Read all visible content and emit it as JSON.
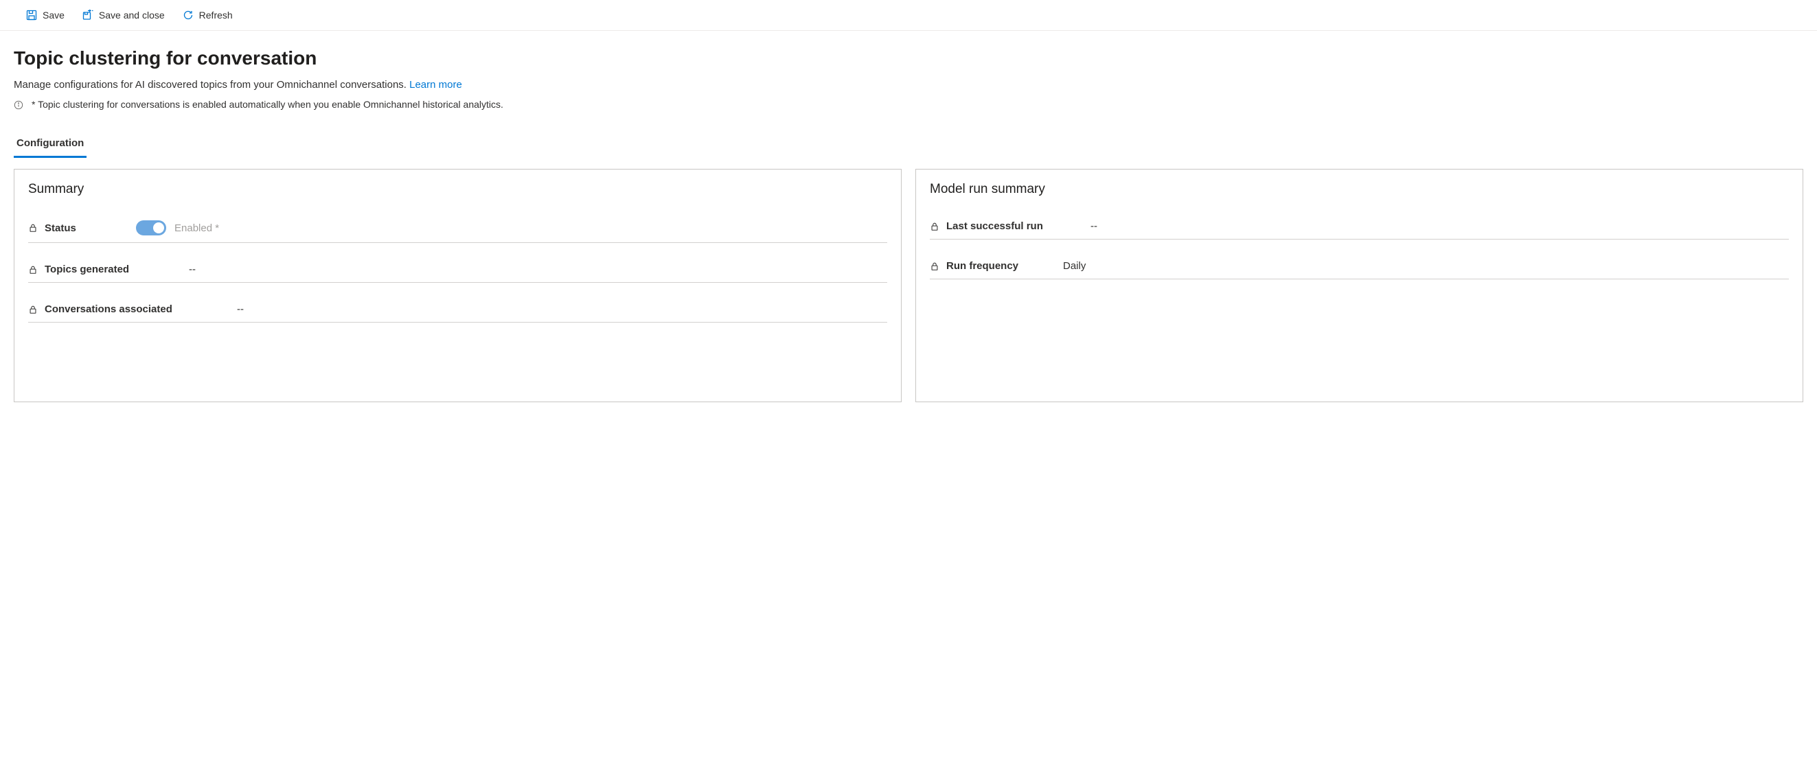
{
  "toolbar": {
    "save_label": "Save",
    "save_close_label": "Save and close",
    "refresh_label": "Refresh"
  },
  "header": {
    "title": "Topic clustering for conversation",
    "subtitle": "Manage configurations for AI discovered topics from your Omnichannel conversations. ",
    "learn_more": "Learn more",
    "info_note": "* Topic clustering for conversations is enabled automatically when you enable Omnichannel historical analytics."
  },
  "tabs": {
    "configuration": "Configuration"
  },
  "summary_panel": {
    "title": "Summary",
    "status_label": "Status",
    "status_value": "Enabled *",
    "topics_generated_label": "Topics generated",
    "topics_generated_value": "--",
    "conversations_associated_label": "Conversations associated",
    "conversations_associated_value": "--"
  },
  "model_panel": {
    "title": "Model run summary",
    "last_run_label": "Last successful run",
    "last_run_value": "--",
    "frequency_label": "Run frequency",
    "frequency_value": "Daily"
  }
}
